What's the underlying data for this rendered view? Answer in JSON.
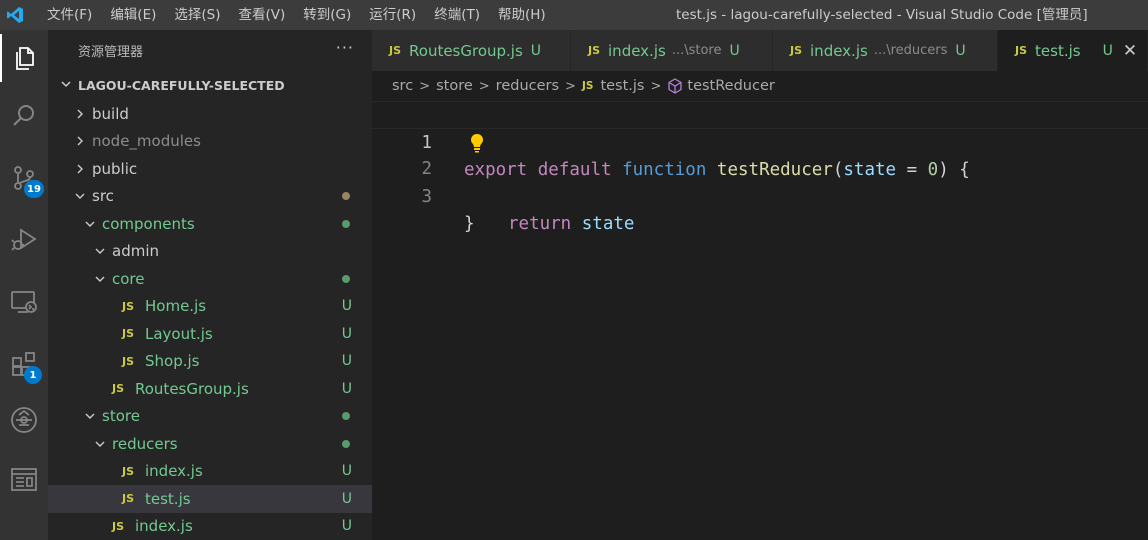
{
  "titlebar": {
    "menu": [
      "文件(F)",
      "编辑(E)",
      "选择(S)",
      "查看(V)",
      "转到(G)",
      "运行(R)",
      "终端(T)",
      "帮助(H)"
    ],
    "window_title": "test.js - lagou-carefully-selected - Visual Studio Code [管理员]"
  },
  "activity": {
    "items": [
      {
        "name": "explorer-icon",
        "active": true
      },
      {
        "name": "search-icon"
      },
      {
        "name": "source-control-icon",
        "badge": "19"
      },
      {
        "name": "run-debug-icon"
      },
      {
        "name": "remote-explorer-icon"
      },
      {
        "name": "extensions-icon",
        "badge": "1"
      },
      {
        "name": "gitlens-icon"
      },
      {
        "name": "browser-preview-icon"
      }
    ]
  },
  "sidebar": {
    "title": "资源管理器",
    "more": "···",
    "project": "LAGOU-CAREFULLY-SELECTED",
    "tree": [
      {
        "label": "build",
        "kind": "folder",
        "depth": 0,
        "color": "default"
      },
      {
        "label": "node_modules",
        "kind": "folder",
        "depth": 0,
        "color": "gray"
      },
      {
        "label": "public",
        "kind": "folder",
        "depth": 0,
        "color": "default"
      },
      {
        "label": "src",
        "kind": "folder-open",
        "depth": 0,
        "color": "default",
        "dot": "#9a8563"
      },
      {
        "label": "components",
        "kind": "folder-open",
        "depth": 1,
        "color": "green",
        "dot": "#5a9b6e"
      },
      {
        "label": "admin",
        "kind": "folder-open",
        "depth": 2,
        "color": "default"
      },
      {
        "label": "core",
        "kind": "folder-open",
        "depth": 2,
        "color": "green",
        "dot": "#5a9b6e"
      },
      {
        "label": "Home.js",
        "kind": "js",
        "depth": 3,
        "color": "green",
        "status": "U"
      },
      {
        "label": "Layout.js",
        "kind": "js",
        "depth": 3,
        "color": "green",
        "status": "U"
      },
      {
        "label": "Shop.js",
        "kind": "js",
        "depth": 3,
        "color": "green",
        "status": "U"
      },
      {
        "label": "RoutesGroup.js",
        "kind": "js",
        "depth": 2,
        "color": "green",
        "status": "U"
      },
      {
        "label": "store",
        "kind": "folder-open",
        "depth": 1,
        "color": "green",
        "dot": "#5a9b6e"
      },
      {
        "label": "reducers",
        "kind": "folder-open",
        "depth": 2,
        "color": "green",
        "dot": "#5a9b6e"
      },
      {
        "label": "index.js",
        "kind": "js",
        "depth": 3,
        "color": "green",
        "status": "U"
      },
      {
        "label": "test.js",
        "kind": "js",
        "depth": 3,
        "color": "green",
        "status": "U",
        "selected": true
      },
      {
        "label": "index.js",
        "kind": "js",
        "depth": 2,
        "color": "green",
        "status": "U"
      }
    ]
  },
  "tabs": [
    {
      "icon": "JS",
      "name": "RoutesGroup.js",
      "desc": "",
      "status": "U"
    },
    {
      "icon": "JS",
      "name": "index.js",
      "desc": "...\\store",
      "status": "U"
    },
    {
      "icon": "JS",
      "name": "index.js",
      "desc": "...\\reducers",
      "status": "U"
    },
    {
      "icon": "JS",
      "name": "test.js",
      "desc": "",
      "status": "U",
      "active": true,
      "close": "✕"
    }
  ],
  "breadcrumbs": {
    "parts": [
      "src",
      "store",
      "reducers"
    ],
    "file_icon": "JS",
    "file": "test.js",
    "symbol": "testReducer"
  },
  "editor": {
    "line_numbers": [
      "1",
      "2",
      "3"
    ],
    "line1": {
      "t1": "export",
      "t2": "default",
      "t3": "function",
      "t4": "testReducer",
      "t5": "(",
      "t6": "state",
      "t7": " = ",
      "t8": "0",
      "t9": ") {"
    },
    "line2": {
      "t1": "return",
      "t2": "state"
    },
    "line3": {
      "t1": "}"
    }
  },
  "colors": {
    "accent": "#007acc",
    "untracked_green": "#73c991",
    "js_yellow": "#cbcb41"
  }
}
